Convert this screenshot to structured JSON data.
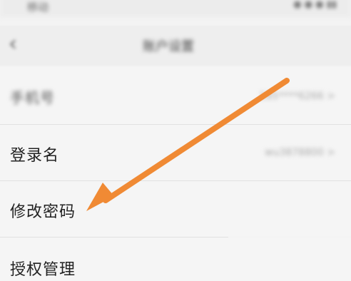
{
  "status_bar": {
    "left_text": "移动",
    "right_text": "● ● ● ▮▮"
  },
  "nav": {
    "back_glyph": "‹",
    "title": "账户设置"
  },
  "rows": [
    {
      "label": "手机号",
      "value": "185****6266 >"
    },
    {
      "label": "登录名",
      "value": "wu3878800 >"
    },
    {
      "label": "修改密码",
      "value": ""
    },
    {
      "label": "授权管理",
      "value": ""
    }
  ],
  "annotation": {
    "arrow_color": "#f08a34",
    "arrow_icon": "arrow-pointer-icon"
  }
}
